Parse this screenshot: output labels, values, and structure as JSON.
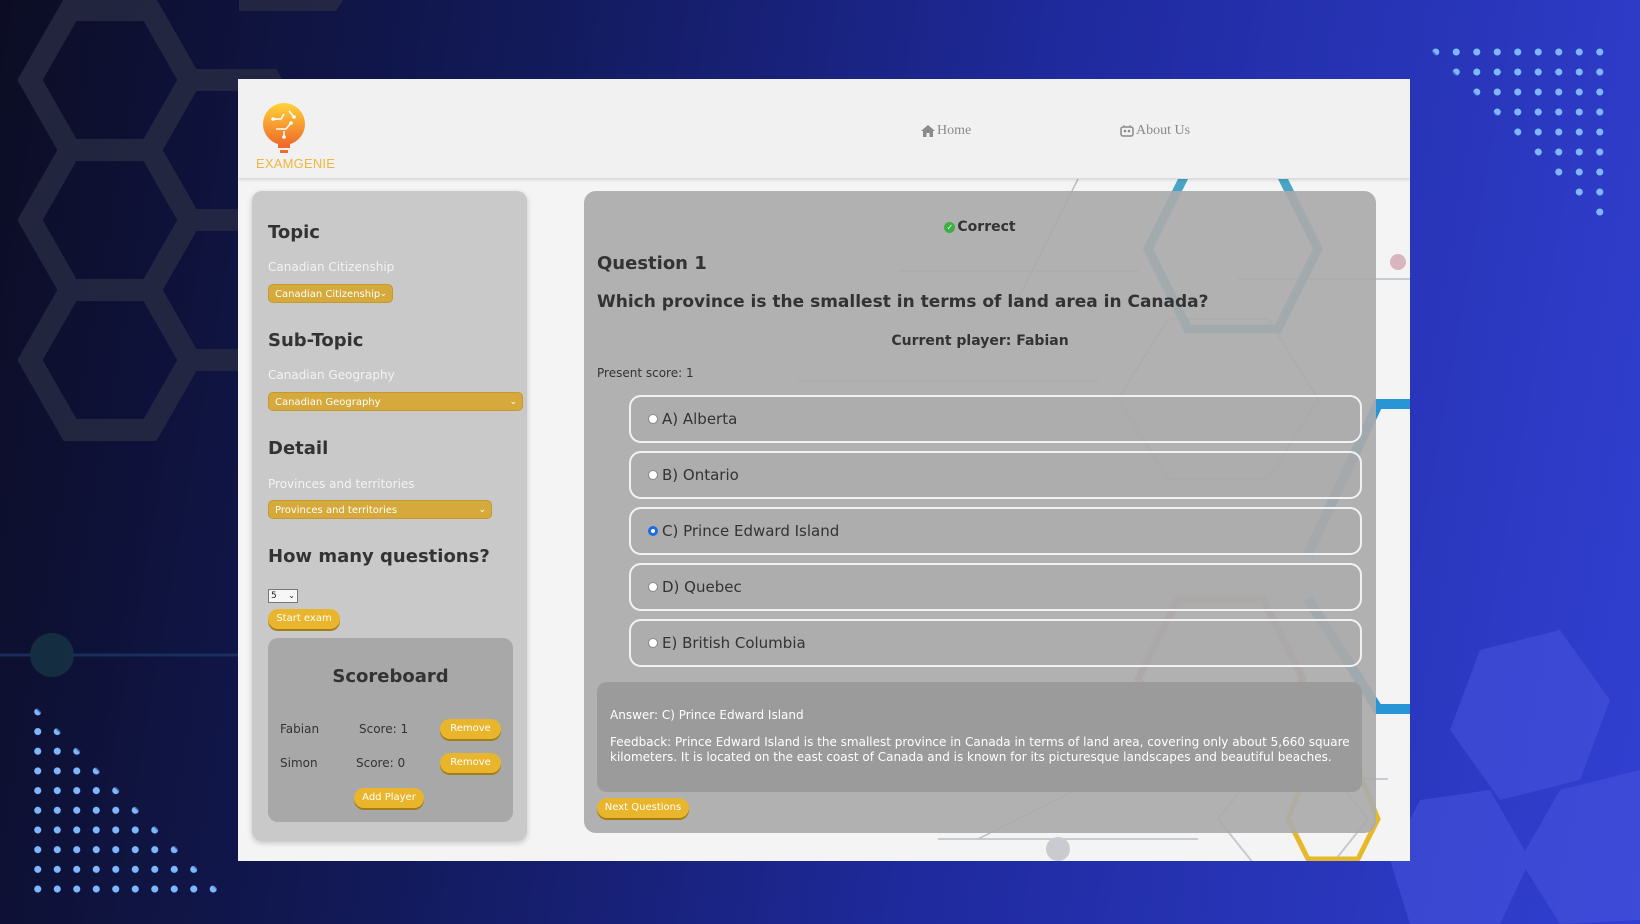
{
  "brand": {
    "name": "EXAMGENIE"
  },
  "nav": {
    "home": "Home",
    "about": "About Us"
  },
  "sidebar": {
    "topic": {
      "heading": "Topic",
      "current": "Canadian Citizenship",
      "select_value": "Canadian Citizenship"
    },
    "subtopic": {
      "heading": "Sub-Topic",
      "current": "Canadian Geography",
      "select_value": "Canadian Geography"
    },
    "detail": {
      "heading": "Detail",
      "current": "Provinces and territories",
      "select_value": "Provinces and territories"
    },
    "questions": {
      "heading": "How many questions?",
      "select_value": "5",
      "start_label": "Start exam"
    }
  },
  "scoreboard": {
    "title": "Scoreboard",
    "players": [
      {
        "name": "Fabian",
        "score": "Score: 1",
        "remove_label": "Remove"
      },
      {
        "name": "Simon",
        "score": "Score: 0",
        "remove_label": "Remove"
      }
    ],
    "add_label": "Add Player"
  },
  "quiz": {
    "status": "Correct",
    "question_number": "Question 1",
    "question_text": "Which province is the smallest in terms of land area in Canada?",
    "current_player": "Current player: Fabian",
    "present_score": "Present score: 1",
    "options": [
      {
        "label": "A) Alberta",
        "selected": false
      },
      {
        "label": "B) Ontario",
        "selected": false
      },
      {
        "label": "C) Prince Edward Island",
        "selected": true
      },
      {
        "label": "D) Quebec",
        "selected": false
      },
      {
        "label": "E) British Columbia",
        "selected": false
      }
    ],
    "answer": "Answer: C) Prince Edward Island",
    "feedback": "Feedback: Prince Edward Island is the smallest province in Canada in terms of land area, covering only about 5,660 square kilometers. It is located on the east coast of Canada and is known for its picturesque landscapes and beautiful beaches.",
    "next_label": "Next Questions"
  },
  "colors": {
    "accent": "#e8b52c",
    "selected_radio": "#1c6ce8",
    "correct": "#3cb043"
  },
  "icons": [
    "logo-bulb-icon",
    "home-icon",
    "about-icon",
    "check-circle-icon",
    "chevron-down-icon"
  ]
}
